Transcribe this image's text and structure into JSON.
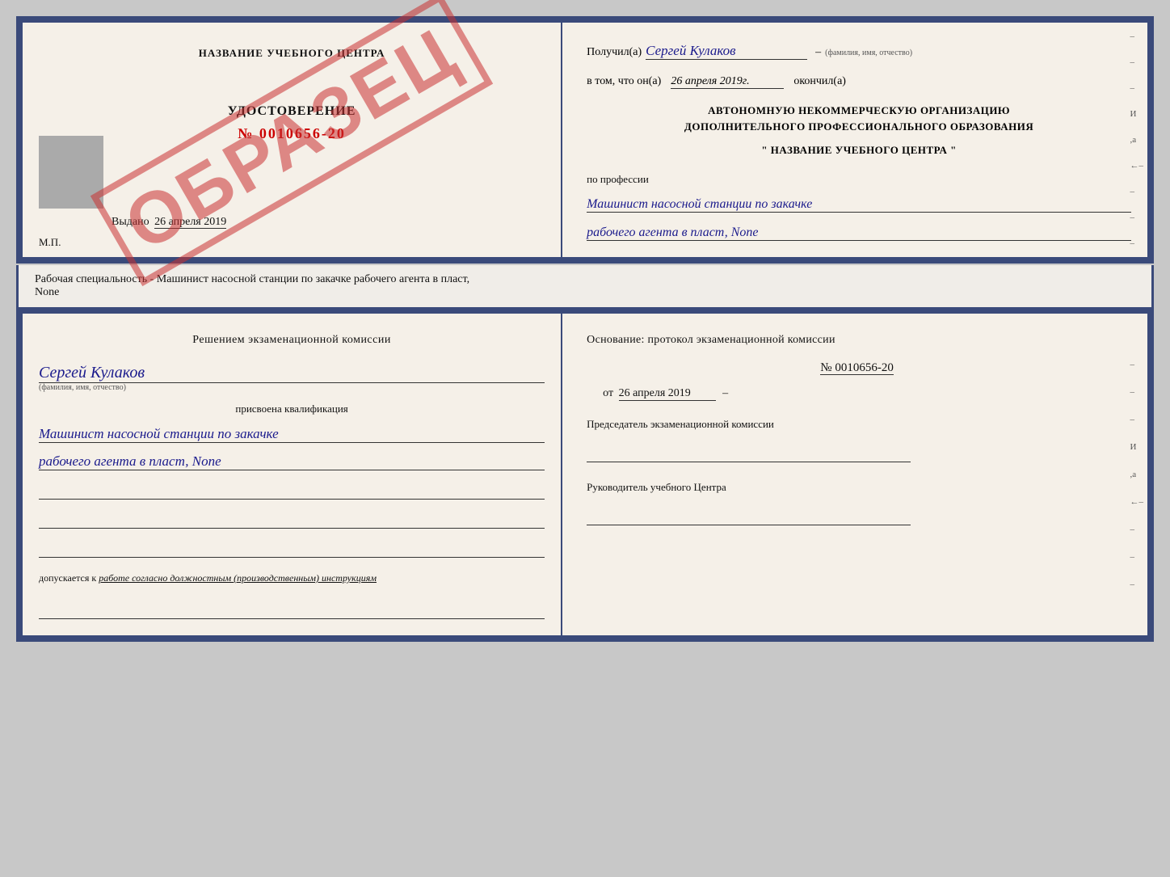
{
  "top_document": {
    "left": {
      "title": "НАЗВАНИЕ УЧЕБНОГО ЦЕНТРА",
      "watermark": "ОБРАЗЕЦ",
      "cert_title": "УДОСТОВЕРЕНИЕ",
      "cert_number": "№ 0010656-20",
      "issued_label": "Выдано",
      "issued_date": "26 апреля 2019",
      "mp_label": "М.П."
    },
    "right": {
      "received_label": "Получил(а)",
      "received_name": "Сергей Кулаков",
      "fio_hint": "(фамилия, имя, отчество)",
      "dash": "–",
      "date_label": "в том, что он(а)",
      "date_value": "26 апреля 2019г.",
      "finished_label": "окончил(а)",
      "org_line1": "АВТОНОМНУЮ НЕКОММЕРЧЕСКУЮ ОРГАНИЗАЦИЮ",
      "org_line2": "ДОПОЛНИТЕЛЬНОГО ПРОФЕССИОНАЛЬНОГО ОБРАЗОВАНИЯ",
      "org_name": "\" НАЗВАНИЕ УЧЕБНОГО ЦЕНТРА \"",
      "profession_label": "по профессии",
      "profession_line1": "Машинист насосной станции по закачке",
      "profession_line2": "рабочего агента в пласт, None",
      "side_marks": [
        "-",
        "-",
        "-",
        "И",
        "а",
        "←",
        "-",
        "-",
        "-"
      ]
    }
  },
  "middle": {
    "text": "Рабочая специальность - Машинист насосной станции по закачке рабочего агента в пласт,",
    "text2": "None"
  },
  "bottom_document": {
    "left": {
      "decision_text": "Решением  экзаменационной  комиссии",
      "person_name": "Сергей Кулаков",
      "fio_hint": "(фамилия, имя, отчество)",
      "assigned_text": "присвоена квалификация",
      "qualification_line1": "Машинист насосной станции по закачке",
      "qualification_line2": "рабочего агента в пласт, None",
      "blank_lines": [
        "",
        "",
        ""
      ],
      "allowed_text": "допускается к",
      "allowed_italic": "работе согласно должностным (производственным) инструкциям",
      "blank_bottom": ""
    },
    "right": {
      "basis_text": "Основание: протокол экзаменационной комиссии",
      "protocol_number": "№ 0010656-20",
      "protocol_date_prefix": "от",
      "protocol_date": "26 апреля 2019",
      "dash_right": "–",
      "chairman_label": "Председатель экзаменационной комиссии",
      "head_label": "Руководитель учебного Центра",
      "side_marks": [
        "-",
        "-",
        "-",
        "И",
        "а",
        "←",
        "-",
        "-",
        "-"
      ]
    }
  }
}
